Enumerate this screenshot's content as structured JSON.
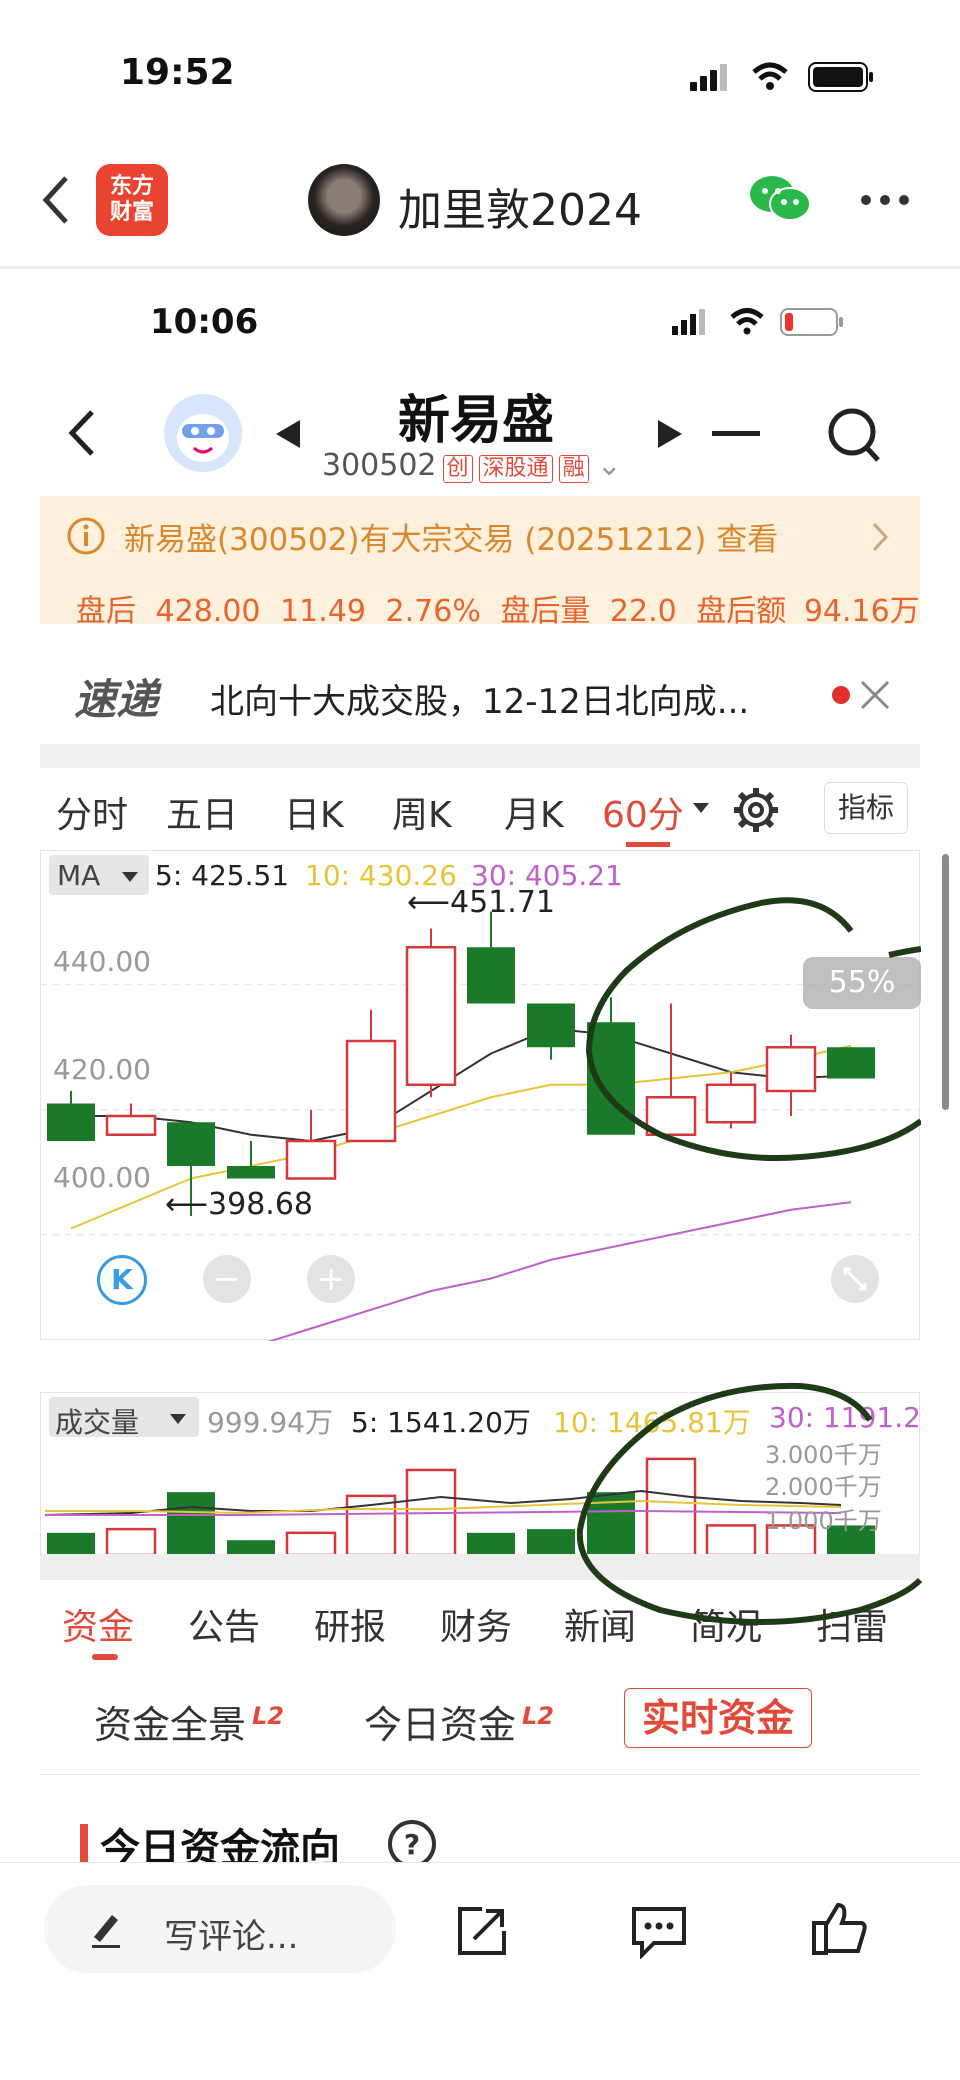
{
  "outer_status": {
    "time": "19:52"
  },
  "outer_nav": {
    "app_logo_text_1": "东方",
    "app_logo_text_2": "财富",
    "user_name": "加里敦2024"
  },
  "inner_status": {
    "time": "10:06"
  },
  "stock_header": {
    "name": "新易盛",
    "code": "300502",
    "tags": [
      "创",
      "深股通",
      "融"
    ]
  },
  "notice": {
    "text": "新易盛(300502)有大宗交易 (20251212) 查看"
  },
  "after_hours": {
    "label": "盘后",
    "price": "428.00",
    "change": "11.49",
    "pct": "2.76%",
    "vol_label": "盘后量",
    "vol": "22.0",
    "amt_label": "盘后额",
    "amt": "94.16万"
  },
  "news_ticker": {
    "brand": "速递",
    "text": "北向十大成交股，12-12日北向成..."
  },
  "period_tabs": {
    "items": [
      "分时",
      "五日",
      "日K",
      "周K",
      "月K",
      "60分"
    ],
    "active": "60分",
    "indicator_button": "指标"
  },
  "kline_chart": {
    "indicator": "MA",
    "ma5": "5: 425.51",
    "ma10": "10: 430.26",
    "ma30": "30: 405.21",
    "high_label": "451.71",
    "low_label": "398.68",
    "zoom_badge": "55%",
    "k_button": "K",
    "minus": "−",
    "plus": "+"
  },
  "chart_data": [
    {
      "type": "candlestick",
      "title": "",
      "ylim": [
        391,
        455
      ],
      "yticks": [
        "440.00",
        "420.00",
        "400.00"
      ],
      "candles": [
        {
          "o": 421,
          "h": 423,
          "l": 415,
          "c": 415,
          "dir": "down"
        },
        {
          "o": 416,
          "h": 421,
          "l": 416,
          "c": 419,
          "dir": "up"
        },
        {
          "o": 418,
          "h": 418,
          "l": 403,
          "c": 411,
          "dir": "down"
        },
        {
          "o": 411,
          "h": 415,
          "l": 409,
          "c": 409,
          "dir": "down"
        },
        {
          "o": 409,
          "h": 420,
          "l": 409,
          "c": 415,
          "dir": "up"
        },
        {
          "o": 415,
          "h": 436,
          "l": 415,
          "c": 431,
          "dir": "up"
        },
        {
          "o": 424,
          "h": 449,
          "l": 422,
          "c": 446,
          "dir": "up"
        },
        {
          "o": 446,
          "h": 451.71,
          "l": 437,
          "c": 437,
          "dir": "down"
        },
        {
          "o": 437,
          "h": 437,
          "l": 428,
          "c": 430,
          "dir": "down"
        },
        {
          "o": 434,
          "h": 438,
          "l": 416,
          "c": 416,
          "dir": "down"
        },
        {
          "o": 416,
          "h": 437,
          "l": 416,
          "c": 422,
          "dir": "up"
        },
        {
          "o": 418,
          "h": 426,
          "l": 417,
          "c": 424,
          "dir": "up"
        },
        {
          "o": 423,
          "h": 432,
          "l": 419,
          "c": 430,
          "dir": "up"
        },
        {
          "o": 430,
          "h": 430,
          "l": 425,
          "c": 425,
          "dir": "down"
        }
      ],
      "ma_series": [
        {
          "name": "5",
          "color": "#333333",
          "values": [
            419,
            419,
            418,
            416,
            415,
            417,
            423,
            429,
            433,
            432,
            429,
            426,
            425,
            425.51
          ]
        },
        {
          "name": "10",
          "color": "#e8c43a",
          "values": [
            401,
            405,
            409,
            411,
            413,
            416,
            419,
            422,
            424,
            424,
            425,
            426,
            428,
            430.26
          ]
        },
        {
          "name": "30",
          "color": "#c061cb",
          "values": [
            373,
            376,
            379,
            382,
            385,
            388,
            391,
            393,
            396,
            398,
            400,
            402,
            404,
            405.21
          ]
        }
      ]
    },
    {
      "type": "bar",
      "title": "",
      "ylim": [
        0,
        3.3
      ],
      "yticks": [
        "3.000千万",
        "2.000千万",
        "1.000千万"
      ],
      "values": [
        0.6,
        0.7,
        1.7,
        0.4,
        0.6,
        1.6,
        2.3,
        0.6,
        0.7,
        1.7,
        2.6,
        0.8,
        0.8,
        0.8
      ],
      "dirs": [
        "down",
        "up",
        "down",
        "down",
        "up",
        "up",
        "up",
        "down",
        "down",
        "down",
        "up",
        "up",
        "up",
        "down"
      ]
    }
  ],
  "volume_chart": {
    "label": "成交量",
    "cur": "999.94万",
    "ma5": "5: 1541.20万",
    "ma10": "10: 1465.81万",
    "ma30": "30: 1191.2"
  },
  "content_tabs": {
    "items": [
      "资金",
      "公告",
      "研报",
      "财务",
      "新闻",
      "简况",
      "扫雷"
    ],
    "active": "资金"
  },
  "fund_tabs": {
    "items": [
      "资金全景",
      "今日资金",
      "实时资金"
    ],
    "l2": "L2"
  },
  "section": {
    "title": "今日资金流向"
  },
  "bottom_bar": {
    "comment_placeholder": "写评论..."
  },
  "colors": {
    "up": "#d5373a",
    "down": "#1b7a2a",
    "accent": "#e04a3a",
    "ma10": "#e8c43a",
    "ma30": "#c061cb"
  }
}
